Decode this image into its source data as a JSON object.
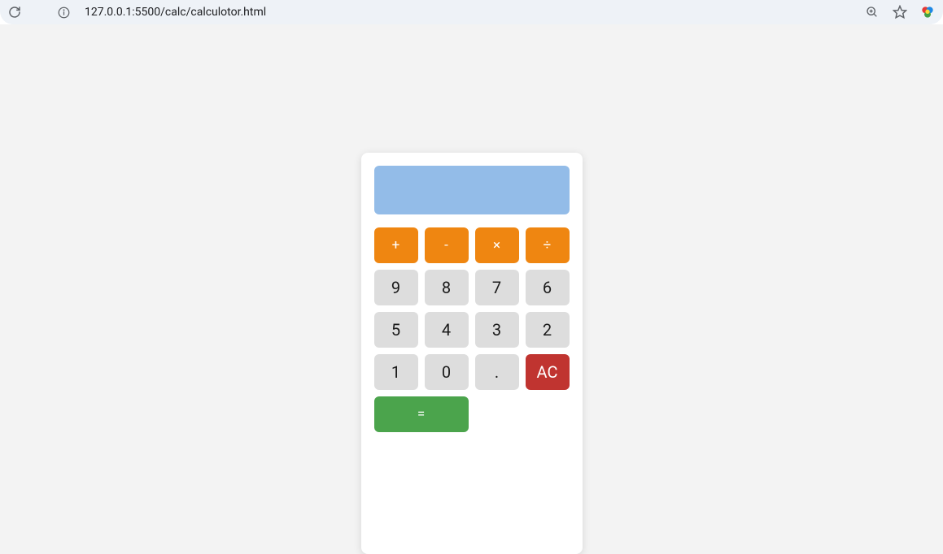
{
  "browser": {
    "url": "127.0.0.1:5500/calc/calculotor.html"
  },
  "calculator": {
    "display_value": "",
    "operators": {
      "add": "+",
      "subtract": "-",
      "multiply": "×",
      "divide": "÷"
    },
    "digits": {
      "nine": "9",
      "eight": "8",
      "seven": "7",
      "six": "6",
      "five": "5",
      "four": "4",
      "three": "3",
      "two": "2",
      "one": "1",
      "zero": "0"
    },
    "decimal": ".",
    "clear": "AC",
    "equals": "="
  }
}
